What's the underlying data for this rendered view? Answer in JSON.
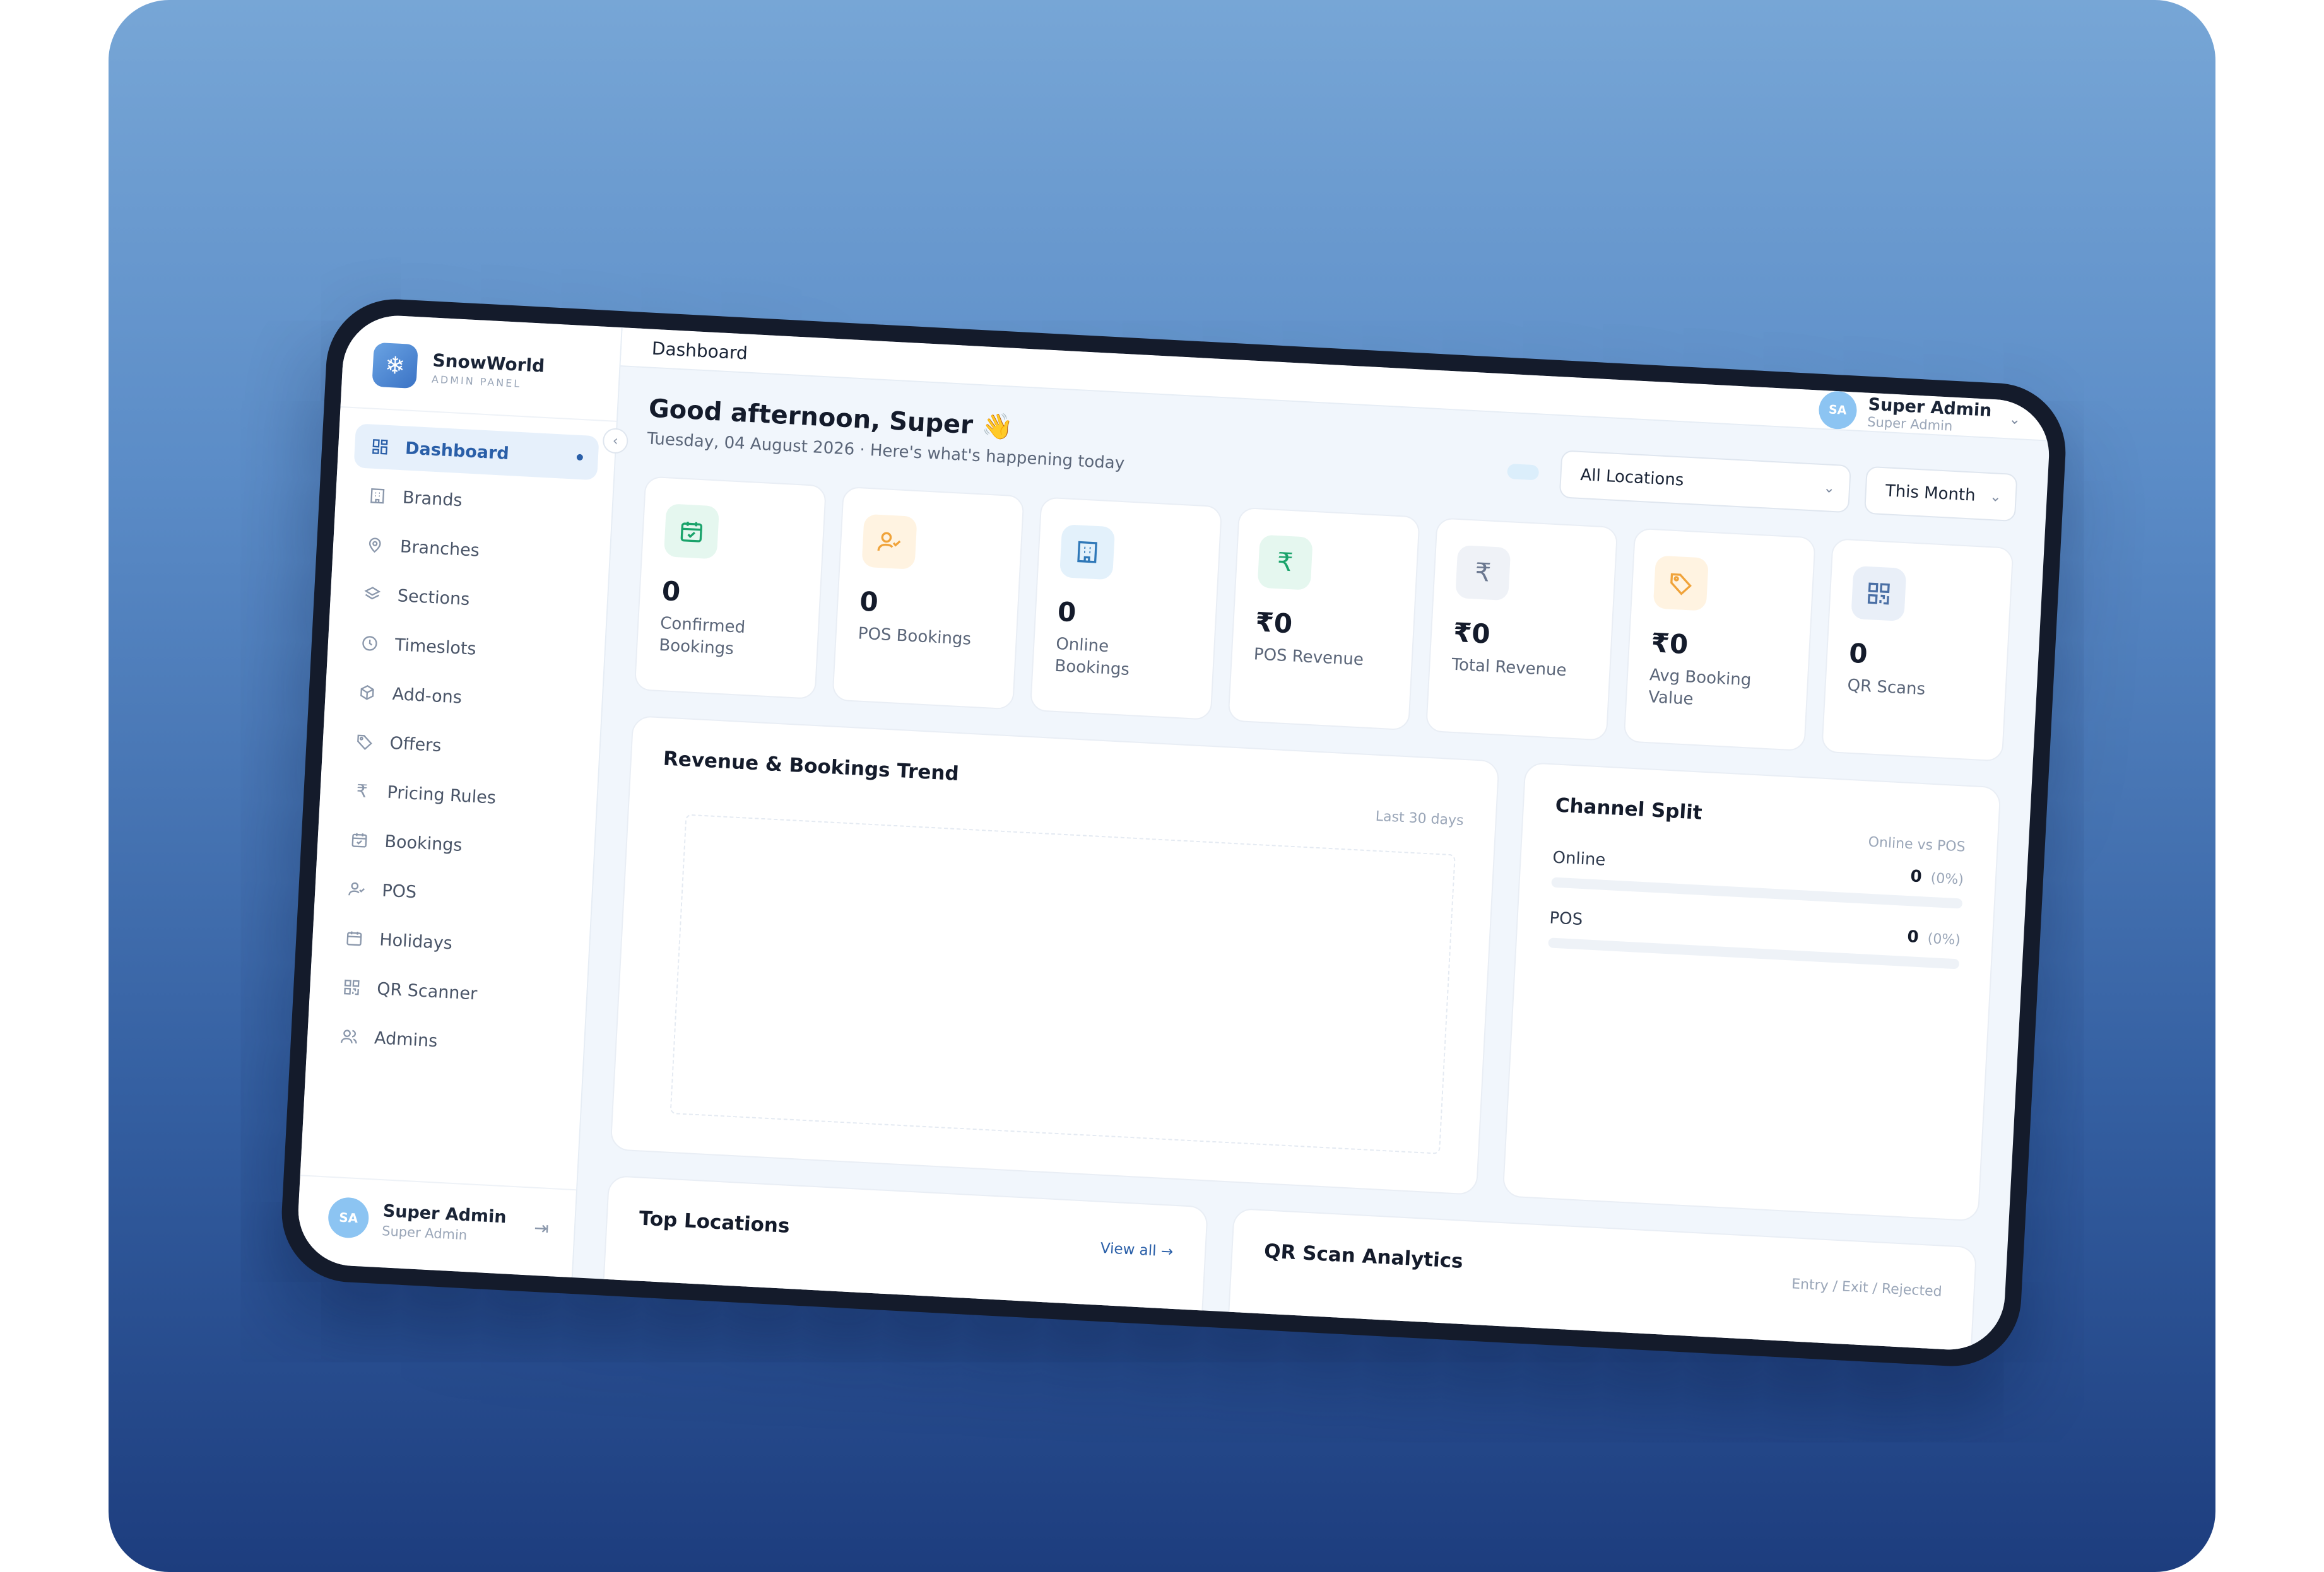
{
  "brand": {
    "name": "SnowWorld",
    "sub": "ADMIN PANEL"
  },
  "sidebar": {
    "items": [
      {
        "label": "Dashboard",
        "icon": "dashboard-icon",
        "active": true
      },
      {
        "label": "Brands",
        "icon": "building-icon"
      },
      {
        "label": "Branches",
        "icon": "map-pin-icon"
      },
      {
        "label": "Sections",
        "icon": "layers-icon"
      },
      {
        "label": "Timeslots",
        "icon": "clock-icon"
      },
      {
        "label": "Add-ons",
        "icon": "package-icon"
      },
      {
        "label": "Offers",
        "icon": "tag-icon"
      },
      {
        "label": "Pricing Rules",
        "icon": "rupee-icon"
      },
      {
        "label": "Bookings",
        "icon": "calendar-check-icon"
      },
      {
        "label": "POS",
        "icon": "user-check-icon"
      },
      {
        "label": "Holidays",
        "icon": "calendar-icon"
      },
      {
        "label": "QR Scanner",
        "icon": "qr-icon"
      },
      {
        "label": "Admins",
        "icon": "users-icon"
      }
    ],
    "footer": {
      "initials": "SA",
      "name": "Super Admin",
      "role": "Super Admin"
    }
  },
  "topbar": {
    "title": "Dashboard",
    "user": {
      "initials": "SA",
      "name": "Super Admin",
      "role": "Super Admin"
    }
  },
  "greeting": {
    "title": "Good afternoon, Super 👋",
    "subtitle": "Tuesday, 04 August 2026 · Here's what's happening today"
  },
  "filters": {
    "location": "All Locations",
    "period": "This Month"
  },
  "stats": [
    {
      "value": "0",
      "label": "Confirmed Bookings",
      "icon": "calendar-check-icon",
      "color": "#1aa36b",
      "bg": "#e5f7ef"
    },
    {
      "value": "0",
      "label": "POS Bookings",
      "icon": "user-check-icon",
      "color": "#f0a33a",
      "bg": "#fff3e1"
    },
    {
      "value": "0",
      "label": "Online Bookings",
      "icon": "building-icon",
      "color": "#2f78b8",
      "bg": "#e3f1fb"
    },
    {
      "value": "₹0",
      "label": "POS Revenue",
      "icon": "rupee-icon",
      "color": "#1aa36b",
      "bg": "#e5f7ef"
    },
    {
      "value": "₹0",
      "label": "Total Revenue",
      "icon": "rupee-icon",
      "color": "#6b7890",
      "bg": "#eff2f7"
    },
    {
      "value": "₹0",
      "label": "Avg Booking Value",
      "icon": "tag-icon",
      "color": "#f0a33a",
      "bg": "#fff3e1"
    },
    {
      "value": "0",
      "label": "QR Scans",
      "icon": "qr-icon",
      "color": "#4a6fa5",
      "bg": "#e9eff8"
    }
  ],
  "trend": {
    "title": "Revenue & Bookings Trend",
    "meta": "Last 30 days"
  },
  "split": {
    "title": "Channel Split",
    "meta": "Online vs POS",
    "rows": [
      {
        "label": "Online",
        "value": "0",
        "pct": "(0%)"
      },
      {
        "label": "POS",
        "value": "0",
        "pct": "(0%)"
      }
    ]
  },
  "locations": {
    "title": "Top Locations",
    "link": "View all →"
  },
  "qr": {
    "title": "QR Scan Analytics",
    "meta": "Entry / Exit / Rejected"
  }
}
